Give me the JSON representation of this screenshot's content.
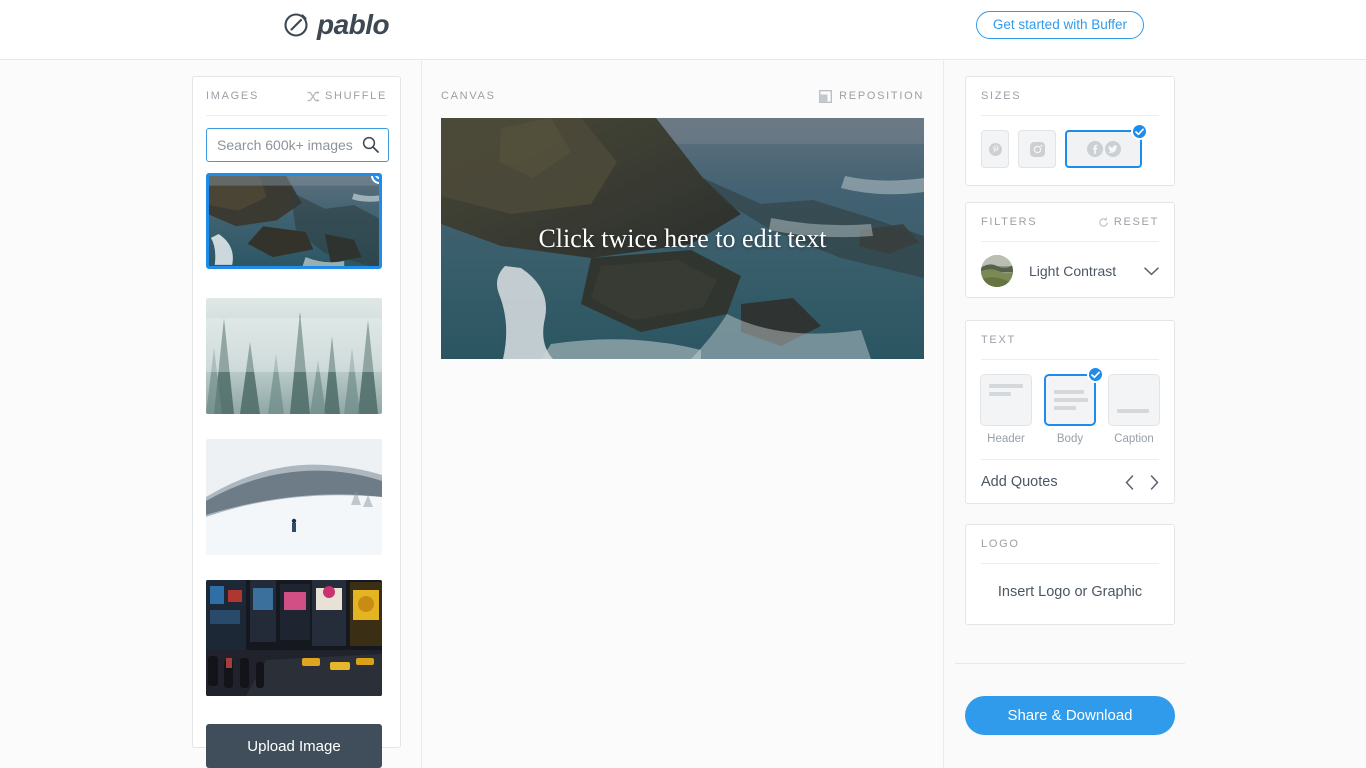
{
  "header": {
    "brand": "pablo",
    "brand_icon": "pablo-circle-slash-icon",
    "cta_label": "Get started with Buffer",
    "accent_color": "#2f9bea"
  },
  "images_panel": {
    "title": "IMAGES",
    "shuffle_label": "SHUFFLE",
    "shuffle_icon": "shuffle-icon",
    "search": {
      "placeholder": "Search 600k+ images",
      "value": "",
      "icon": "search-icon"
    },
    "thumbnails": [
      {
        "alt": "coastal cliffs and rocky sea",
        "selected": true
      },
      {
        "alt": "misty evergreen forest",
        "selected": false
      },
      {
        "alt": "snowy slope with lone skier",
        "selected": false
      },
      {
        "alt": "night city street with billboards",
        "selected": false
      }
    ],
    "upload_label": "Upload Image"
  },
  "canvas": {
    "title": "CANVAS",
    "reposition_label": "REPOSITION",
    "reposition_icon": "reposition-icon",
    "overlay_text": "Click twice here to edit text"
  },
  "sizes": {
    "title": "SIZES",
    "options": [
      {
        "name": "pinterest",
        "icon": "pinterest-icon",
        "selected": false
      },
      {
        "name": "instagram",
        "icon": "instagram-icon",
        "selected": false
      },
      {
        "name": "facebook-twitter",
        "icon": "facebook-twitter-icon",
        "selected": true
      }
    ]
  },
  "filters": {
    "title": "FILTERS",
    "reset_label": "RESET",
    "reset_icon": "reset-icon",
    "selected_filter": "Light Contrast",
    "chevron_icon": "chevron-down-icon"
  },
  "text": {
    "title": "TEXT",
    "options": [
      {
        "label": "Header",
        "selected": false
      },
      {
        "label": "Body",
        "selected": true
      },
      {
        "label": "Caption",
        "selected": false
      }
    ],
    "quotes_label": "Add Quotes",
    "prev_icon": "chevron-left-icon",
    "next_icon": "chevron-right-icon"
  },
  "logo_section": {
    "title": "LOGO",
    "placeholder": "Insert Logo or Graphic"
  },
  "footer": {
    "share_label": "Share & Download"
  }
}
